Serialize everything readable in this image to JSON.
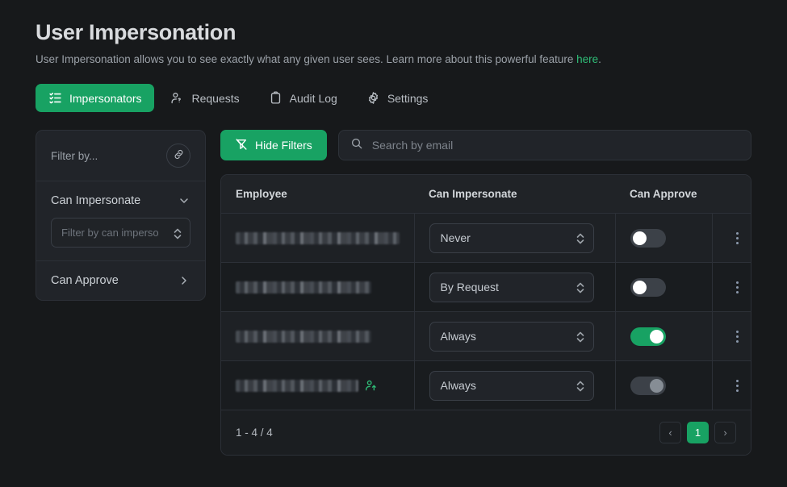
{
  "header": {
    "title": "User Impersonation",
    "subtitle_before": "User Impersonation allows you to see exactly what any given user sees. Learn more about this powerful feature ",
    "subtitle_link": "here",
    "subtitle_after": ".",
    "accent_color": "#18a263",
    "link_color": "#2fbd77"
  },
  "tabs": [
    {
      "label": "Impersonators",
      "icon": "list-check-icon",
      "active": true
    },
    {
      "label": "Requests",
      "icon": "person-question-icon",
      "active": false
    },
    {
      "label": "Audit Log",
      "icon": "clipboard-icon",
      "active": false
    },
    {
      "label": "Settings",
      "icon": "gear-icon",
      "active": false
    }
  ],
  "filters": {
    "filter_by_label": "Filter by...",
    "link_icon": "link-icon",
    "sections": [
      {
        "label": "Can Impersonate",
        "expanded": true,
        "chevron": "chevron-down-icon",
        "select_placeholder": "Filter by can impersonate"
      },
      {
        "label": "Can Approve",
        "expanded": false,
        "chevron": "chevron-right-icon"
      }
    ]
  },
  "toolbar": {
    "hide_filters_label": "Hide Filters",
    "hide_filters_icon": "filter-off-icon",
    "search_icon": "search-icon",
    "search_placeholder": "Search by email",
    "search_value": ""
  },
  "table": {
    "columns": [
      "Employee",
      "Can Impersonate",
      "Can Approve",
      ""
    ],
    "rows": [
      {
        "employee_redacted": true,
        "employee_width": 205,
        "has_user_add_icon": false,
        "can_impersonate": "Never",
        "can_approve": false,
        "can_approve_state": "off",
        "menu_icon": "kebab-menu-icon"
      },
      {
        "employee_redacted": true,
        "employee_width": 168,
        "has_user_add_icon": false,
        "can_impersonate": "By Request",
        "can_approve": false,
        "can_approve_state": "off",
        "menu_icon": "kebab-menu-icon"
      },
      {
        "employee_redacted": true,
        "employee_width": 168,
        "has_user_add_icon": false,
        "can_impersonate": "Always",
        "can_approve": true,
        "can_approve_state": "on",
        "menu_icon": "kebab-menu-icon"
      },
      {
        "employee_redacted": true,
        "employee_width": 152,
        "has_user_add_icon": true,
        "user_add_icon": "person-add-icon",
        "can_impersonate": "Always",
        "can_approve": true,
        "can_approve_state": "disabled",
        "menu_icon": "kebab-menu-icon"
      }
    ],
    "impersonate_options": [
      "Never",
      "By Request",
      "Always"
    ]
  },
  "footer": {
    "count_label": "1 - 4 / 4",
    "prev_label": "‹",
    "next_label": "›",
    "pages": [
      "1"
    ],
    "current_page": "1"
  }
}
